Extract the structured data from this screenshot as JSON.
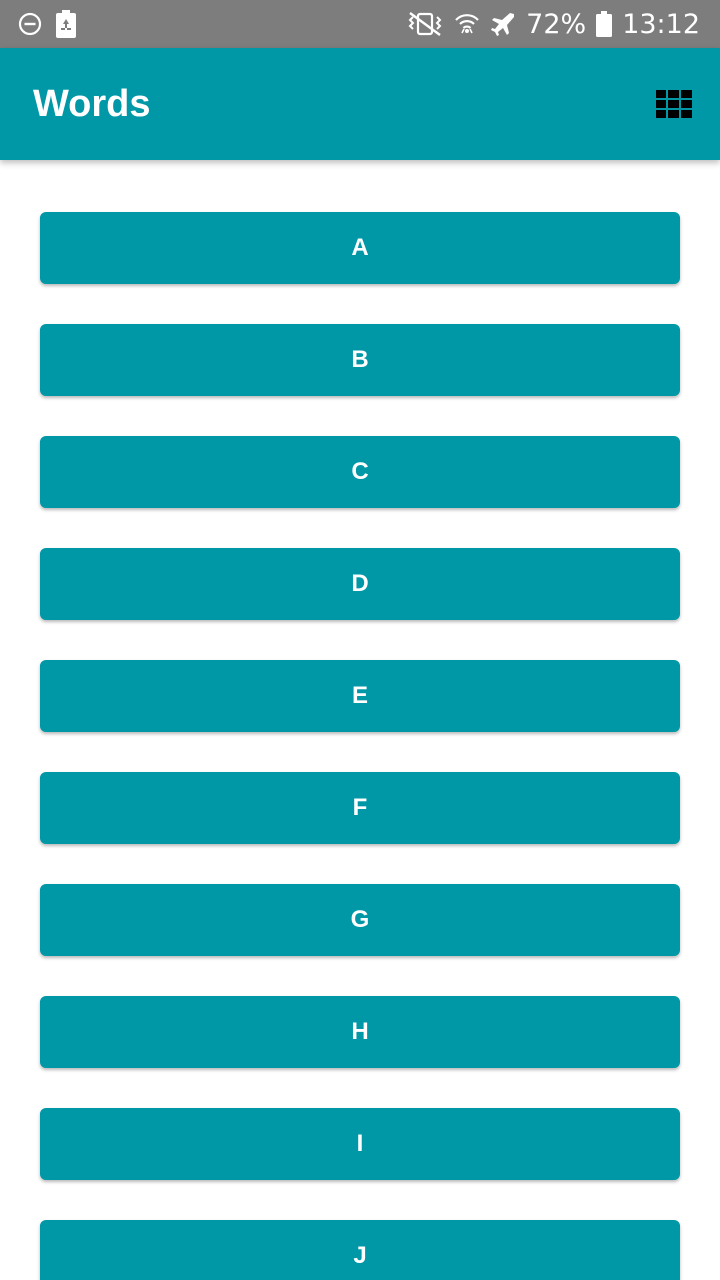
{
  "status_bar": {
    "icons_left": [
      "do-not-disturb-icon",
      "battery-saver-icon"
    ],
    "icons_right": [
      "vibrate-icon",
      "wifi-icon",
      "airplane-mode-icon",
      "battery-icon"
    ],
    "battery_percent": "72%",
    "time": "13:12",
    "background_color": "#7d7d7d"
  },
  "app_bar": {
    "title": "Words",
    "action_icon": "grid-view-icon",
    "color": "#0097a7"
  },
  "letters": [
    {
      "label": "A"
    },
    {
      "label": "B"
    },
    {
      "label": "C"
    },
    {
      "label": "D"
    },
    {
      "label": "E"
    },
    {
      "label": "F"
    },
    {
      "label": "G"
    },
    {
      "label": "H"
    },
    {
      "label": "I"
    },
    {
      "label": "J"
    }
  ]
}
